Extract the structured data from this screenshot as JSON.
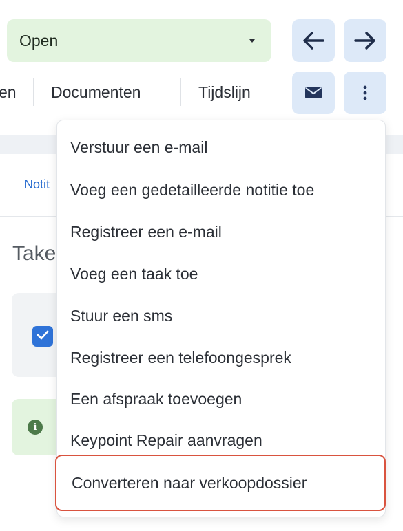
{
  "status_select": {
    "value": "Open"
  },
  "nav": {
    "back_icon": "arrow-left-icon",
    "forward_icon": "arrow-right-icon"
  },
  "tabs": [
    {
      "label": "en"
    },
    {
      "label": "Documenten"
    },
    {
      "label": "Tijdslijn"
    }
  ],
  "toolbar": {
    "mail_icon": "envelope-icon",
    "more_icon": "vertical-dots-icon"
  },
  "sub_tab": {
    "label": "Notit"
  },
  "section": {
    "title": "Take"
  },
  "menu": {
    "items": [
      {
        "label": "Verstuur een e-mail"
      },
      {
        "label": "Voeg een gedetailleerde notitie toe"
      },
      {
        "label": "Registreer een e-mail"
      },
      {
        "label": "Voeg een taak toe"
      },
      {
        "label": "Stuur een sms"
      },
      {
        "label": "Registreer een telefoongesprek"
      },
      {
        "label": "Een afspraak toevoegen"
      },
      {
        "label": "Keypoint Repair aanvragen"
      },
      {
        "label": "Converteren naar verkoopdossier",
        "highlighted": true
      }
    ]
  },
  "colors": {
    "status_bg": "#e3f4df",
    "icon_button_bg": "#dde9f8",
    "accent_blue": "#2c6fd1",
    "highlight_border": "#d9533f"
  }
}
